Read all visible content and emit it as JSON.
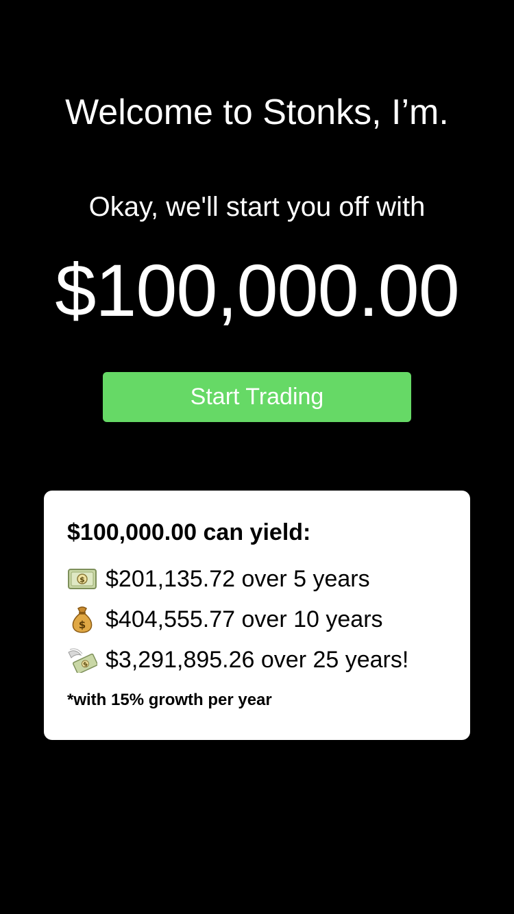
{
  "welcome": {
    "title": "Welcome to Stonks, I’m.",
    "subtitle": "Okay, we'll start you off with",
    "amount": "$100,000.00",
    "start_button_label": "Start Trading"
  },
  "yield_card": {
    "title": "$100,000.00 can yield:",
    "rows": [
      {
        "icon": "dollar-banknote-icon",
        "text": "$201,135.72 over 5 years"
      },
      {
        "icon": "money-bag-icon",
        "text": "$404,555.77 over 10 years"
      },
      {
        "icon": "money-with-wings-icon",
        "text": "$3,291,895.26 over 25 years!"
      }
    ],
    "footnote": "*with 15% growth per year"
  },
  "colors": {
    "background": "#000000",
    "accent_green": "#66d966",
    "card_background": "#ffffff"
  }
}
